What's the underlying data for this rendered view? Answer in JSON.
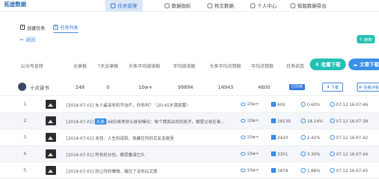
{
  "brand": "拓途数据",
  "nav": [
    {
      "label": "任务管理",
      "active": true
    },
    {
      "label": "数据指标",
      "active": false
    },
    {
      "label": "热文数据",
      "active": false
    },
    {
      "label": "个人中心",
      "active": false
    },
    {
      "label": "智能数据导出",
      "active": false
    }
  ],
  "tabs": [
    {
      "label": "创建任务",
      "active": false
    },
    {
      "label": "任务列表",
      "active": true
    }
  ],
  "back_label": "返回",
  "top_button_label": "刷新",
  "headers": [
    "公众号名称",
    "文章数",
    "7天文章数",
    "头条平均阅读数",
    "平均阅读数",
    "头条平均点赞数",
    "平均点赞数",
    "任务状态"
  ],
  "actions": {
    "batch_download": "批量下载",
    "article_download": "文章下载"
  },
  "summary": {
    "name": "十点读书",
    "articles": "248",
    "week_articles": "0",
    "head_avg_read": "10w+",
    "avg_read": "99894",
    "head_avg_like": "14943",
    "avg_like": "4600",
    "status": "已完成",
    "download_label": "下载",
    "view_label": "查看详情"
  },
  "rows": [
    {
      "idx": "1.",
      "date": "[2019-07-01]",
      "tag": "",
      "title": "女人最该有的不动产，你有吗？（20-45岁请部署）",
      "reads": "10w+",
      "likes": "600",
      "rate": "0.60%",
      "time": "07.12 16:07:46"
    },
    {
      "idx": "2.",
      "date": "[2019-07-01]",
      "tag": "头条",
      "title": "68位高考状元身份曝光：每个精英出世的孩子，都是父母在奋...",
      "reads": "10w+",
      "likes": "18139",
      "rate": "18.14%",
      "time": "07.12 16:07:38"
    },
    {
      "idx": "3.",
      "date": "[2019-07-01]",
      "tag": "",
      "title": "关羽：人生的成败，就藏在你的交友态度里",
      "reads": "10w+",
      "likes": "2420",
      "rate": "2.42%",
      "time": "07.12 16:07:42"
    },
    {
      "idx": "4.",
      "date": "[2019-07-01]",
      "tag": "",
      "title": "所有的分别，都是蓄谋已久",
      "reads": "10w+",
      "likes": "3301",
      "rate": "3.30%",
      "time": "07.12 16:07:44"
    },
    {
      "idx": "5.",
      "date": "[2019-07-01]",
      "tag": "",
      "title": "别让你的懒惰，输在了没有仪式感",
      "reads": "10w+",
      "likes": "1878",
      "rate": "1.88%",
      "time": "07.12 16:07:45"
    }
  ],
  "colors": {
    "accent": "#3a7bd5",
    "teal": "#22c1b3",
    "badge": "#3b7de0"
  }
}
